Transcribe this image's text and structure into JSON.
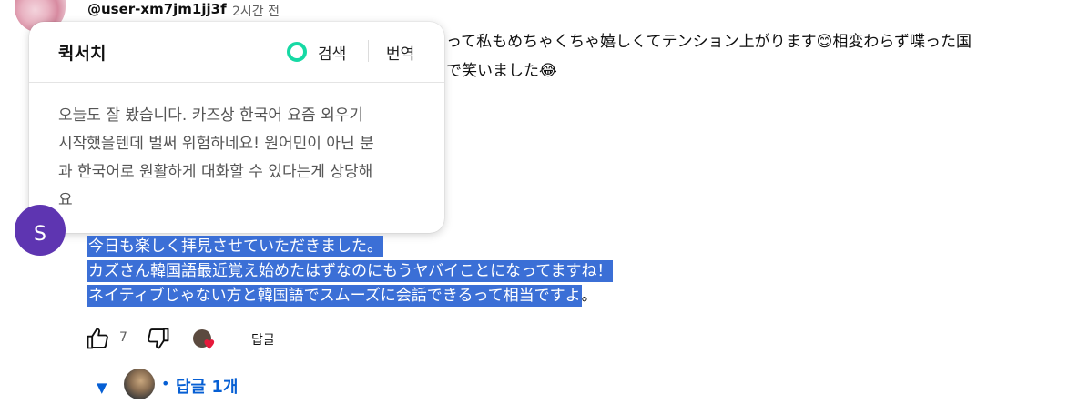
{
  "top_comment": {
    "username": "@user-xm7jm1jj3f",
    "timestamp": "2시간 전",
    "text_line1": "って私もめちゃくちゃ嬉しくてテンション上がります😊相変わらず喋った国",
    "text_line2": "で笑いました😂"
  },
  "popup": {
    "title": "퀵서치",
    "search_label": "검색",
    "translate_label": "번역",
    "translation_lines": [
      "오늘도 잘 봤습니다. 카즈상 한국어 요즘 외우기",
      "시작했을텐데 벌써 위험하네요! 원어민이 아닌 분",
      "과 한국어로 원활하게 대화할 수 있다는게 상당해",
      "요"
    ]
  },
  "second_comment": {
    "avatar_letter": "S",
    "selected_lines": [
      "今日も楽しく拝見させていただきました。",
      "カズさん韓国語最近覚え始めたはずなのにもうヤバイことになってますね！",
      "ネイティブじゃない方と韓国語でスムーズに会話できるって相当ですよ"
    ],
    "tail": "。",
    "like_count": "7",
    "reply_label": "답글",
    "heart_glyph": "♥"
  },
  "replies": {
    "caret": "▼",
    "dot": "•",
    "label": "답글 1개"
  }
}
